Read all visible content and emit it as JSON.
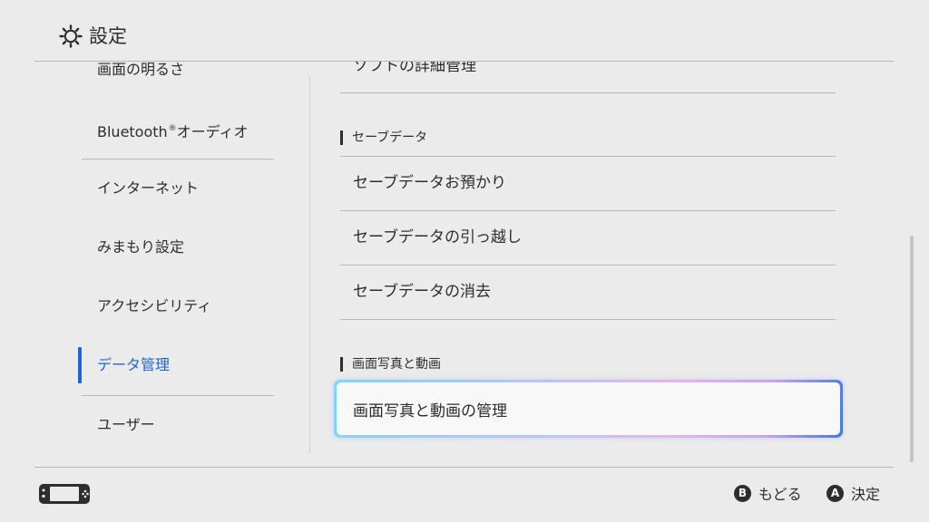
{
  "header": {
    "title": "設定",
    "icon": "gear-icon"
  },
  "sidebar": {
    "items": [
      {
        "label": "画面の明るさ"
      },
      {
        "label": "Bluetooth",
        "mark": "®",
        "label_suffix": "オーディオ"
      },
      {
        "label": "インターネット"
      },
      {
        "label": "みまもり設定"
      },
      {
        "label": "アクセシビリティ"
      },
      {
        "label": "データ管理",
        "active": true
      },
      {
        "label": "ユーザー"
      }
    ]
  },
  "content": {
    "partial_row": "ソフトの詳細管理",
    "sections": [
      {
        "title": "セーブデータ",
        "rows": [
          "セーブデータお預かり",
          "セーブデータの引っ越し",
          "セーブデータの消去"
        ]
      },
      {
        "title": "画面写真と動画",
        "rows": [
          "画面写真と動画の管理"
        ]
      }
    ]
  },
  "footer": {
    "back": {
      "button": "B",
      "label": "もどる"
    },
    "confirm": {
      "button": "A",
      "label": "決定"
    }
  },
  "colors": {
    "background": "#ebebeb",
    "accent": "#1c64d8",
    "text": "#2d2d2d",
    "divider": "#b9b9b9"
  }
}
